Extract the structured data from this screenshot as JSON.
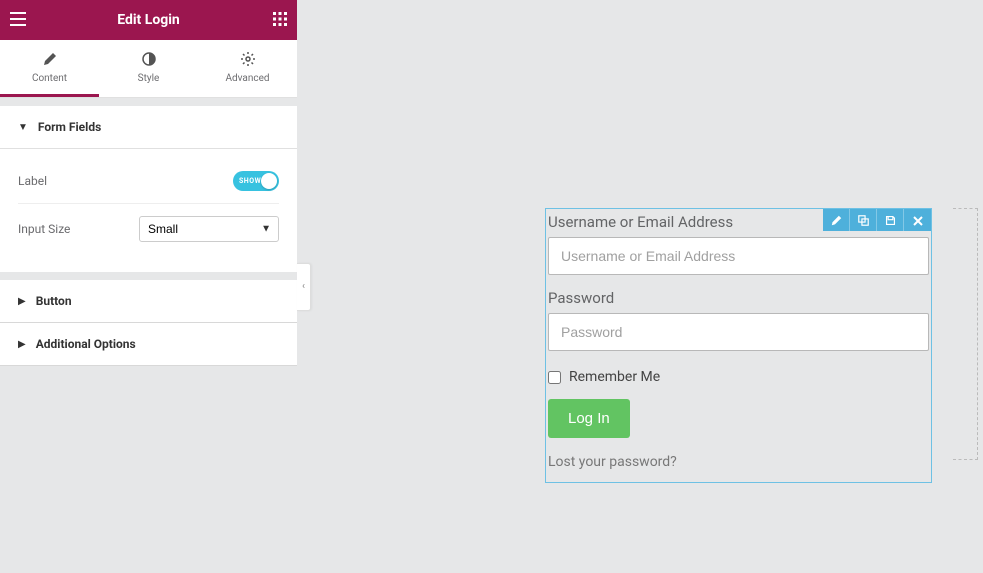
{
  "header": {
    "title": "Edit Login"
  },
  "tabs": {
    "content": "Content",
    "style": "Style",
    "advanced": "Advanced"
  },
  "sections": {
    "form_fields": {
      "title": "Form Fields",
      "label_control": "Label",
      "toggle_text": "SHOW",
      "input_size_label": "Input Size",
      "input_size_value": "Small"
    },
    "button": {
      "title": "Button"
    },
    "additional_options": {
      "title": "Additional Options"
    }
  },
  "preview": {
    "username_label": "Username or Email Address",
    "username_placeholder": "Username or Email Address",
    "password_label": "Password",
    "password_placeholder": "Password",
    "remember_me": "Remember Me",
    "login_button": "Log In",
    "lost_password": "Lost your password?"
  }
}
